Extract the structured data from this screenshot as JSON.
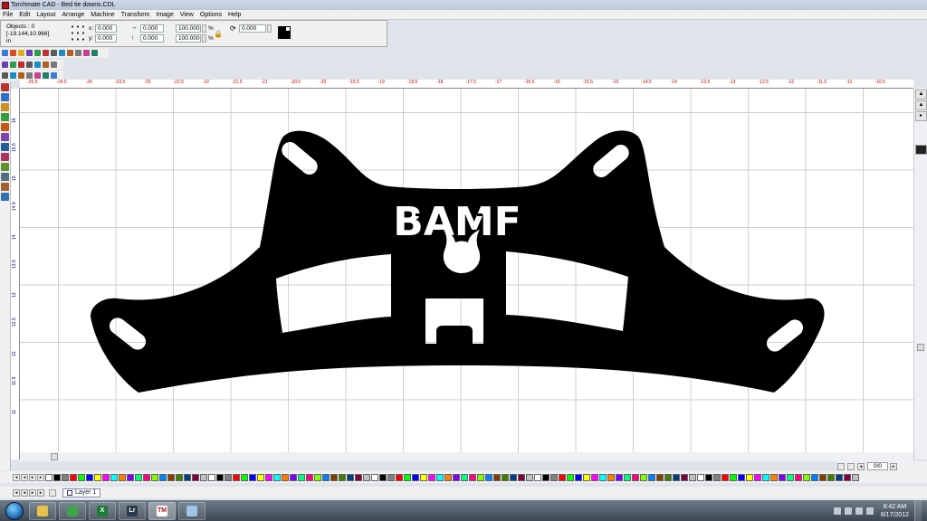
{
  "window": {
    "title": "Torchmate CAD - Bed tie downs.CDL"
  },
  "menu": [
    "File",
    "Edit",
    "Layout",
    "Arrange",
    "Machine",
    "Transform",
    "Image",
    "View",
    "Options",
    "Help"
  ],
  "propbar": {
    "objects_label": "Objects : 0",
    "coords": "[-19.144,10.966]",
    "units": "in",
    "x_label": "x:",
    "x_value": "0.000",
    "y_label": "y:",
    "y_value": "0.000",
    "w_value": "0.000",
    "h_value": "0.000",
    "scale_x": "100.000",
    "scale_y": "100.000",
    "percent": "%",
    "rotation": "0.000"
  },
  "ruler": {
    "h_ticks": [
      "-25.5",
      "-24.5",
      "-24",
      "-23.5",
      "-23",
      "-22.5",
      "-22",
      "-21.5",
      "-21",
      "-20.5",
      "-20",
      "-19.5",
      "-19",
      "-18.5",
      "-18",
      "-17.5",
      "-17",
      "-16.5",
      "-16",
      "-15.5",
      "-15",
      "-14.5",
      "-14",
      "-13.5",
      "-13",
      "-12.5",
      "-12",
      "-11.5",
      "-11",
      "-10.5"
    ],
    "v_ticks": [
      "16",
      "15.5",
      "15",
      "14.5",
      "14",
      "13.5",
      "13",
      "12.5",
      "12",
      "11.5",
      "11"
    ]
  },
  "design": {
    "text": "BAMF"
  },
  "page": {
    "count": "0/0"
  },
  "layer": {
    "name": "Layer 1"
  },
  "taskbar": {
    "apps": [
      {
        "name": "explorer",
        "label": "",
        "color": "#e8c14a"
      },
      {
        "name": "chrome",
        "label": "",
        "color": "#3fa34d"
      },
      {
        "name": "excel",
        "label": "X",
        "color": "#1f7a3a"
      },
      {
        "name": "lightroom",
        "label": "Lr",
        "color": "#2b3a4a"
      },
      {
        "name": "torchmate",
        "label": "TM",
        "color": "#ffffff"
      },
      {
        "name": "notepad",
        "label": "",
        "color": "#9fc4e8"
      }
    ],
    "time": "8:42 AM",
    "date": "8/17/2012"
  },
  "palette_colors": [
    "#ffffff",
    "#000000",
    "#7f7f7f",
    "#ff0000",
    "#00ff00",
    "#0000ff",
    "#ffff00",
    "#ff00ff",
    "#00ffff",
    "#ff8000",
    "#8000ff",
    "#00ff80",
    "#ff0080",
    "#80ff00",
    "#0080ff",
    "#804000",
    "#408000",
    "#004080",
    "#800040",
    "#c0c0c0"
  ],
  "toolbar_colors": [
    "#3a7bd5",
    "#d94c2b",
    "#e0b020",
    "#6a3fb5",
    "#2e9d4f",
    "#c03030",
    "#5a5a5a",
    "#1c8cc8",
    "#b06020",
    "#7a7a7a",
    "#c84090",
    "#208060"
  ],
  "tool_colors": [
    "#c03030",
    "#2d6fcf",
    "#d09020",
    "#3a9a40",
    "#c85a10",
    "#8040b0",
    "#2060a0",
    "#b03060",
    "#609030",
    "#507080",
    "#a06030",
    "#3070b0"
  ]
}
